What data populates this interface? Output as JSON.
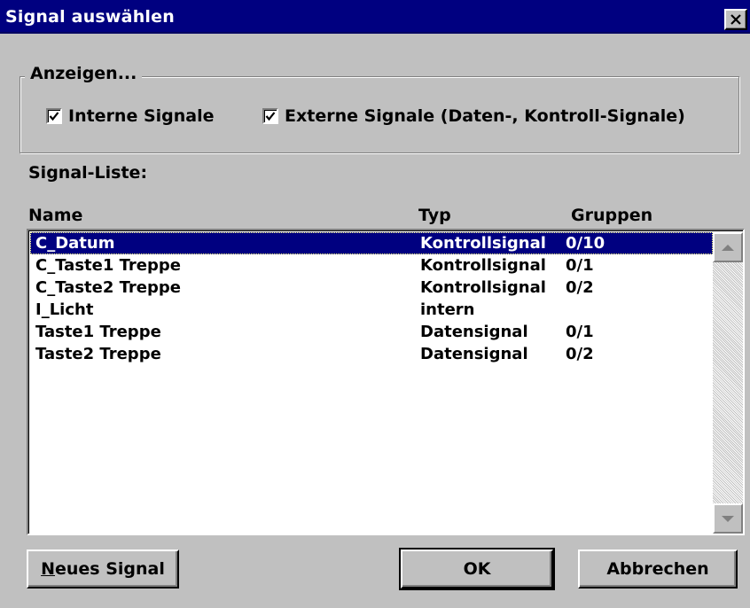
{
  "window": {
    "title": "Signal auswählen",
    "close_label": "×"
  },
  "display_group": {
    "legend": "Anzeigen...",
    "checkboxes": [
      {
        "label": "Interne Signale",
        "checked": true
      },
      {
        "label": "Externe Signale (Daten-, Kontroll-Signale)",
        "checked": true
      }
    ]
  },
  "signal_list": {
    "label": "Signal-Liste:",
    "columns": [
      "Name",
      "Typ",
      "Gruppen"
    ],
    "rows": [
      {
        "name": "C_Datum",
        "typ": "Kontrollsignal",
        "gruppen": "0/10",
        "selected": true
      },
      {
        "name": "C_Taste1 Treppe",
        "typ": "Kontrollsignal",
        "gruppen": "0/1"
      },
      {
        "name": "C_Taste2 Treppe",
        "typ": "Kontrollsignal",
        "gruppen": "0/2"
      },
      {
        "name": "I_Licht",
        "typ": "intern",
        "gruppen": ""
      },
      {
        "name": "Taste1 Treppe",
        "typ": "Datensignal",
        "gruppen": "0/1"
      },
      {
        "name": "Taste2 Treppe",
        "typ": "Datensignal",
        "gruppen": "0/2"
      }
    ]
  },
  "buttons": {
    "new_signal_mnemonic": "N",
    "new_signal_rest": "eues Signal",
    "ok": "OK",
    "cancel": "Abbrechen"
  },
  "colors": {
    "titlebar": "#000080",
    "face": "#c0c0c0",
    "selection": "#000080"
  }
}
